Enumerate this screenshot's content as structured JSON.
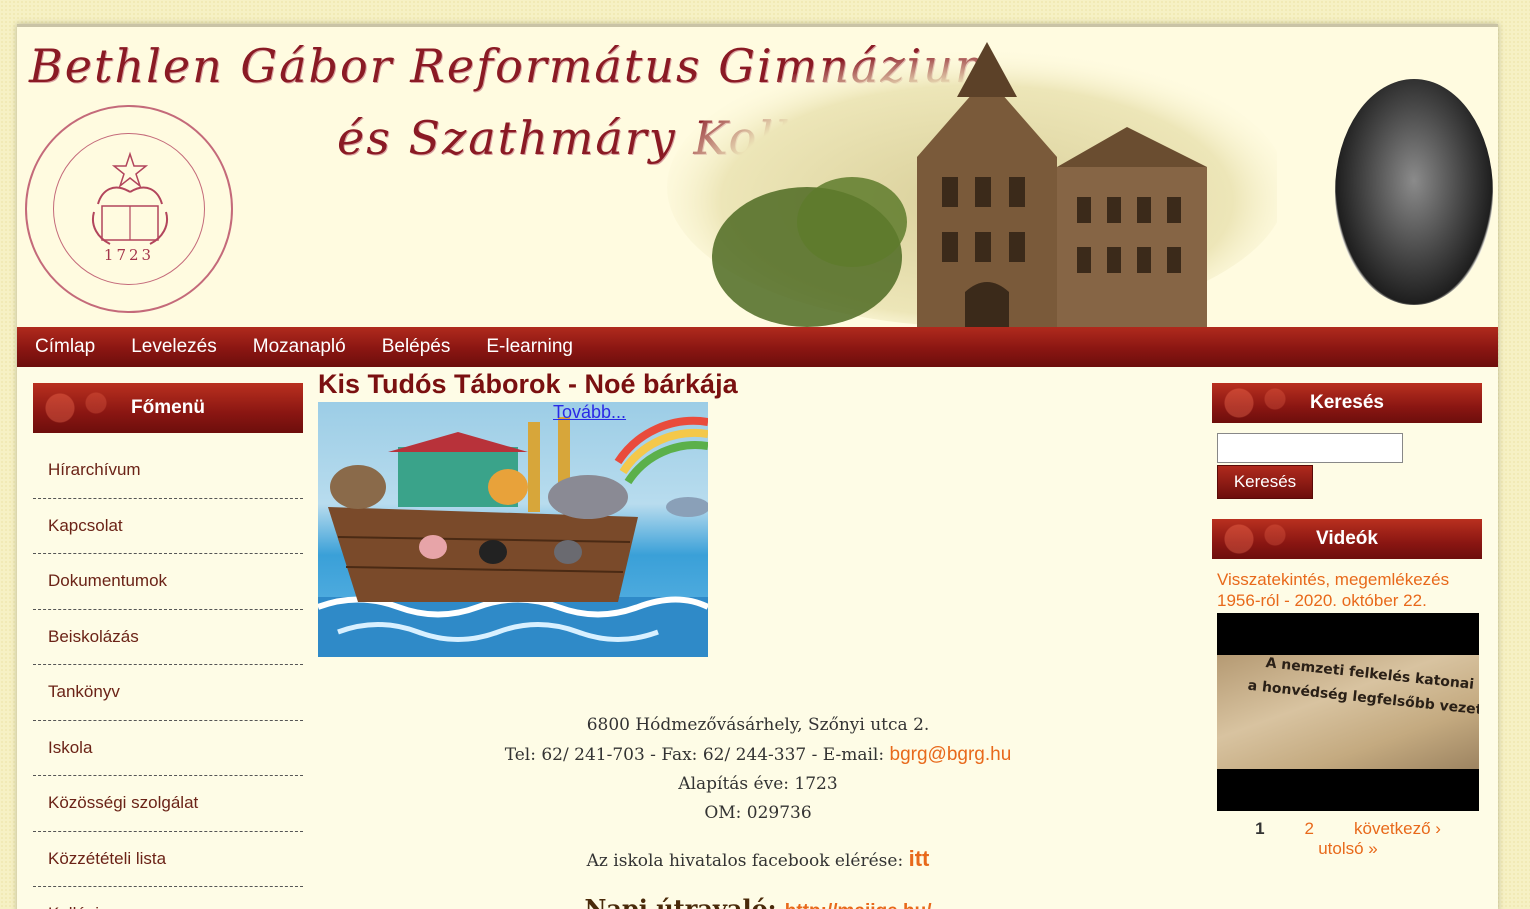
{
  "header": {
    "title_line1": "Bethlen Gábor Református Gimnázium",
    "title_line2": "és Szathmáry Kollégium",
    "seal_year": "1723"
  },
  "nav": {
    "items": [
      "Címlap",
      "Levelezés",
      "Mozanapló",
      "Belépés",
      "E-learning"
    ]
  },
  "sidebar": {
    "title": "Főmenü",
    "items": [
      "Hírarchívum",
      "Kapcsolat",
      "Dokumentumok",
      "Beiskolázás",
      "Tankönyv",
      "Iskola",
      "Közösségi szolgálat",
      "Közzétételi lista",
      "Kollégium"
    ]
  },
  "main": {
    "article_title": "Kis Tudós Táborok - Noé bárkája",
    "more_link": "Tovább...",
    "address": "6800 Hódmezővásárhely, Szőnyi utca 2.",
    "contact_prefix": "Tel: 62/ 241-703 - Fax: 62/ 244-337 - E-mail:",
    "email": "bgrg@bgrg.hu",
    "founded": "Alapítás éve: 1723",
    "om": "OM: 029736",
    "fb_prefix": "Az iskola hivatalos facebook elérése:",
    "fb_link": "itt",
    "napi_prefix": "Napi útravaló:",
    "napi_link": "http://majige.hu/"
  },
  "right": {
    "search_title": "Keresés",
    "search_placeholder": "",
    "search_button": "Keresés",
    "videos_title": "Videók",
    "video_caption": "Visszatekintés, megemlékezés 1956-ról - 2020. október 22.",
    "video_headline1": "A nemzeti felkelés katonai vezető",
    "video_headline2": "a honvédség legfelsőbb vezetésében",
    "pager": {
      "current": "1",
      "page2": "2",
      "next": "következő ›",
      "last": "utolsó »"
    }
  },
  "colors": {
    "brand_red": "#8a1612",
    "link_orange": "#e8691b",
    "page_bg": "#fefce6"
  }
}
